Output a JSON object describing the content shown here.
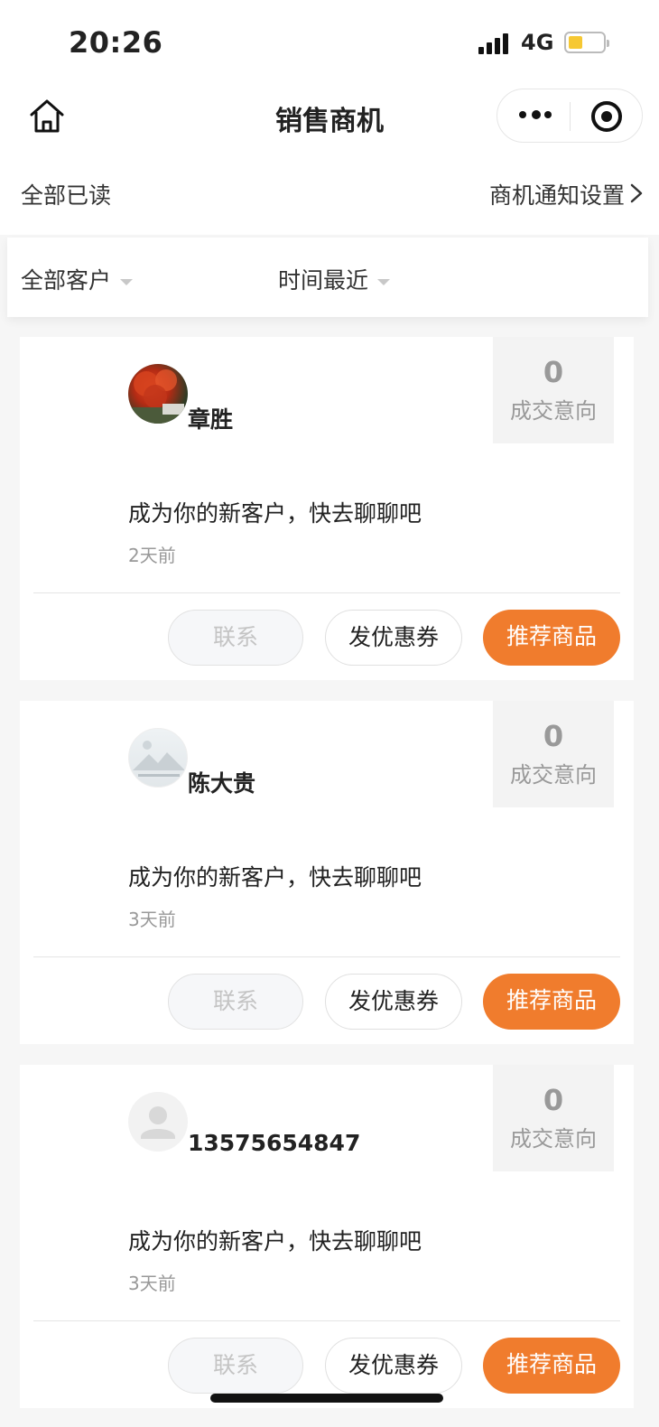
{
  "status_bar": {
    "time": "20:26",
    "network": "4G"
  },
  "nav": {
    "title": "销售商机"
  },
  "actions": {
    "mark_all_read": "全部已读",
    "notify_settings": "商机通知设置"
  },
  "filters": {
    "customer": "全部客户",
    "time": "时间最近"
  },
  "cards": [
    {
      "name": "章胜",
      "intent_count": "0",
      "intent_label": "成交意向",
      "message": "成为你的新客户，快去聊聊吧",
      "time_ago": "2天前",
      "contact": "联系",
      "coupon": "发优惠券",
      "recommend": "推荐商品"
    },
    {
      "name": "陈大贵",
      "intent_count": "0",
      "intent_label": "成交意向",
      "message": "成为你的新客户，快去聊聊吧",
      "time_ago": "3天前",
      "contact": "联系",
      "coupon": "发优惠券",
      "recommend": "推荐商品"
    },
    {
      "name": "13575654847",
      "intent_count": "0",
      "intent_label": "成交意向",
      "message": "成为你的新客户，快去聊聊吧",
      "time_ago": "3天前",
      "contact": "联系",
      "coupon": "发优惠券",
      "recommend": "推荐商品"
    }
  ],
  "icons": {
    "home": "home-icon",
    "more": "more-dots-icon",
    "close": "target-close-icon",
    "chevron": "chevron-right-icon",
    "dropdown": "caret-down-icon"
  },
  "colors": {
    "accent": "#f07c2d",
    "background": "#f6f6f6",
    "muted_text": "#999999"
  }
}
